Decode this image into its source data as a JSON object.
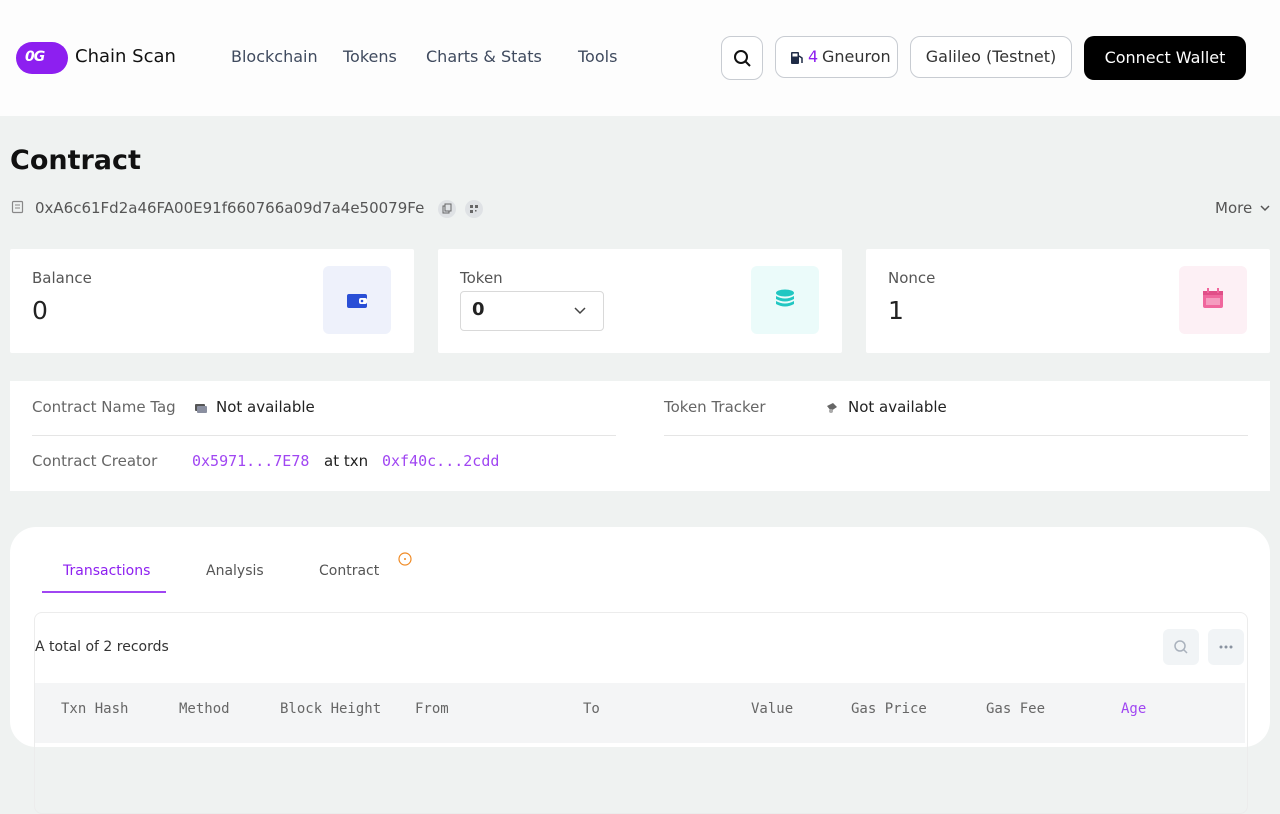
{
  "brand": {
    "logo_text": "0G",
    "name": "Chain Scan"
  },
  "nav": [
    "Blockchain",
    "Tokens",
    "Charts & Stats",
    "Tools"
  ],
  "header": {
    "gas_value": "4",
    "gas_unit": "Gneuron",
    "network": "Galileo (Testnet)",
    "connect_label": "Connect Wallet"
  },
  "page": {
    "title": "Contract",
    "address": "0xA6c61Fd2a46FA00E91f660766a09d7a4e50079Fe",
    "more_label": "More"
  },
  "cards": {
    "balance": {
      "label": "Balance",
      "value": "0"
    },
    "token": {
      "label": "Token",
      "selected": "0"
    },
    "nonce": {
      "label": "Nonce",
      "value": "1"
    }
  },
  "info": {
    "name_tag_label": "Contract Name Tag",
    "name_tag_value": "Not available",
    "tracker_label": "Token Tracker",
    "tracker_value": "Not available",
    "creator_label": "Contract Creator",
    "creator_addr": "0x5971...7E78",
    "at_txn": "at txn",
    "creator_txn": "0xf40c...2cdd"
  },
  "tabs": [
    "Transactions",
    "Analysis",
    "Contract"
  ],
  "table": {
    "records_text": "A total of 2 records",
    "columns": [
      "Txn Hash",
      "Method",
      "Block Height",
      "From",
      "To",
      "Value",
      "Gas Price",
      "Gas Fee",
      "Age"
    ]
  },
  "colors": {
    "accent": "#8d1ff0",
    "link": "#a046f2",
    "dark_button": "#000000"
  }
}
